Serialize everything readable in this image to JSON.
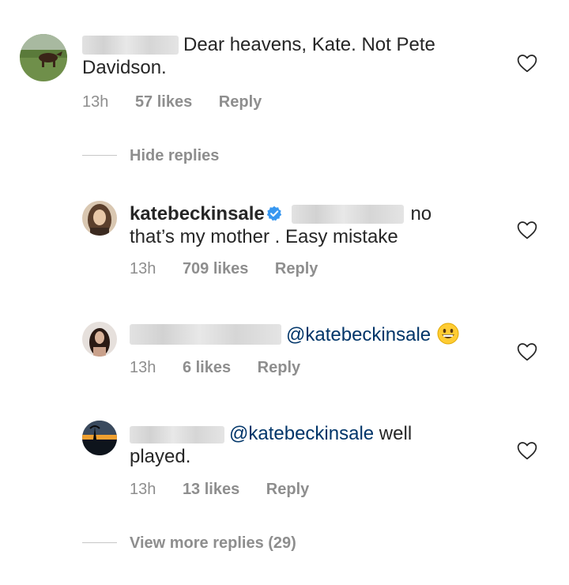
{
  "comments": [
    {
      "text": "Dear heavens, Kate. Not Pete Davidson.",
      "text_line1": "Dear heavens, Kate. Not Pete",
      "text_line2": "Davidson.",
      "time": "13h",
      "likes": "57 likes",
      "reply": "Reply"
    }
  ],
  "hide_replies": "Hide replies",
  "replies": [
    {
      "username": "katebeckinsale",
      "verified": true,
      "text_line1_tail": "no",
      "text_line2": "that’s my mother . Easy mistake",
      "time": "13h",
      "likes": "709 likes",
      "reply": "Reply"
    },
    {
      "mention": "@katebeckinsale",
      "emoji": "grinning-face",
      "time": "13h",
      "likes": "6 likes",
      "reply": "Reply"
    },
    {
      "mention": "@katebeckinsale",
      "text_tail": " well",
      "text_line2": "played.",
      "time": "13h",
      "likes": "13 likes",
      "reply": "Reply"
    }
  ],
  "view_more": "View more replies (29)",
  "colors": {
    "text": "#262626",
    "meta": "#8e8e8e",
    "mention": "#003569",
    "verified": "#3897f0"
  },
  "icons": [
    "heart-outline-icon",
    "verified-badge-icon",
    "grinning-face-emoji"
  ]
}
